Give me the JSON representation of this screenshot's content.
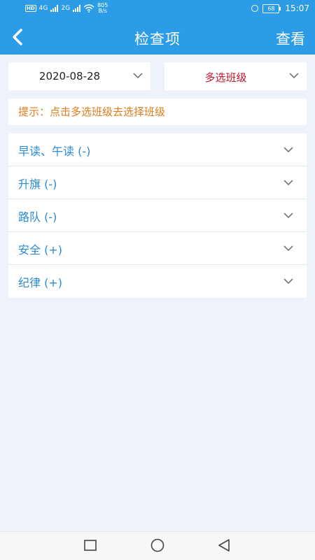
{
  "status_bar": {
    "network_hd": "HD",
    "network_1": "4G",
    "network_2": "2G",
    "speed_value": "805",
    "speed_unit": "B/s",
    "battery": "68",
    "time": "15:07"
  },
  "header": {
    "title": "检查项",
    "action_label": "查看"
  },
  "filters": {
    "date_value": "2020-08-28",
    "class_value": "多选班级"
  },
  "hint": "提示：点击多选班级去选择班级",
  "check_items": [
    {
      "label": "早读、午读 (-)"
    },
    {
      "label": "升旗 (-)"
    },
    {
      "label": "路队 (-)"
    },
    {
      "label": "安全 (+)"
    },
    {
      "label": "纪律 (+)"
    }
  ],
  "colors": {
    "primary": "#2d9ce6",
    "background": "#eef3fb",
    "item_text": "#2a8bd6",
    "hint_text": "#e07c1e",
    "class_text": "#c0152d"
  }
}
